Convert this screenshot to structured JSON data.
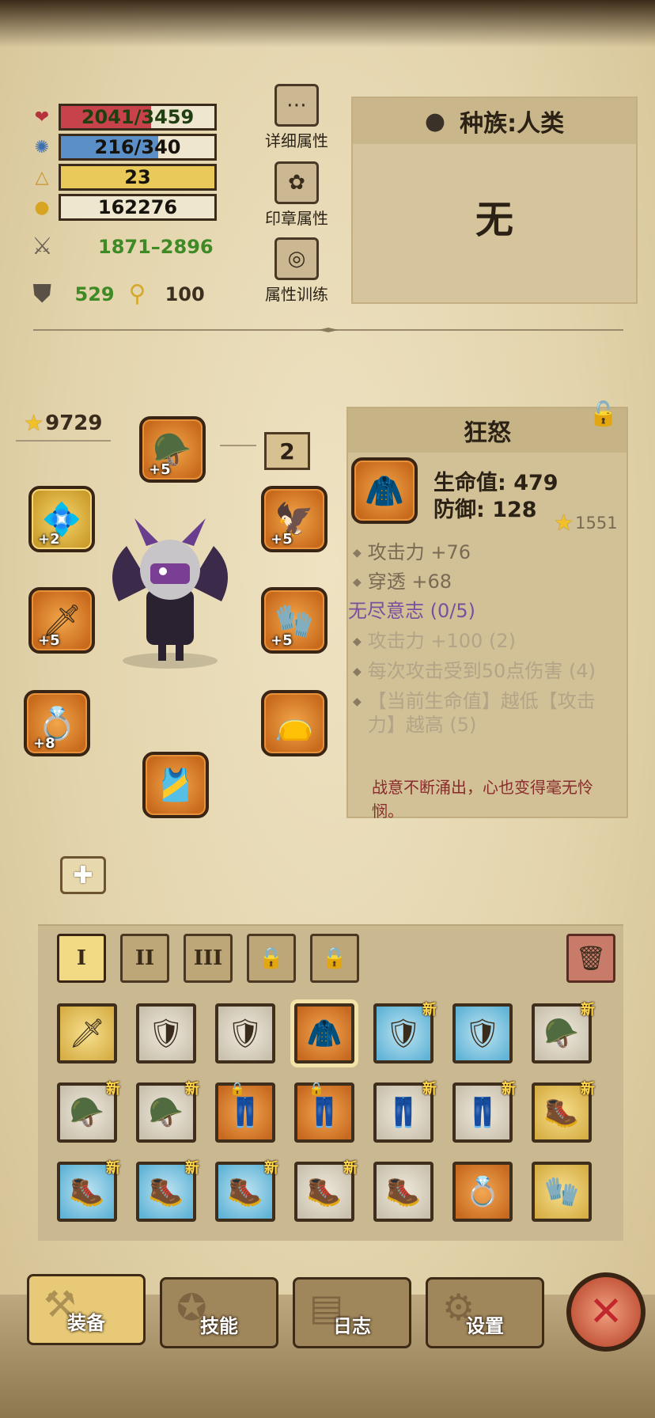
{
  "stats": {
    "hp": {
      "text": "2041/3459",
      "fraction": 0.59,
      "color": "#c8424c"
    },
    "mp": {
      "text": "216/340",
      "fraction": 0.635,
      "color": "#5b8fc7"
    },
    "level": {
      "text": "23",
      "fraction": 1.0,
      "color": "#e8c95a"
    },
    "gold": {
      "text": "162276"
    },
    "attack": "1871–2896",
    "defense": "529",
    "luck": "100"
  },
  "side_buttons": {
    "detail": "详细属性",
    "seal": "印章属性",
    "training": "属性训练"
  },
  "race": {
    "title": "种族:人类",
    "value": "无"
  },
  "equipment": {
    "score": "9729",
    "count": "2",
    "slots": [
      {
        "name": "helmet",
        "level": "+5"
      },
      {
        "name": "amulet",
        "level": "+2"
      },
      {
        "name": "claw",
        "level": "+5"
      },
      {
        "name": "sword",
        "level": "+5"
      },
      {
        "name": "gauntlet",
        "level": "+5"
      },
      {
        "name": "ring",
        "level": "+8"
      },
      {
        "name": "belt",
        "level": ""
      },
      {
        "name": "armor",
        "level": ""
      }
    ]
  },
  "item": {
    "name": "狂怒",
    "hp": "生命值: 479",
    "def": "防御: 128",
    "score": "1551",
    "attrs": [
      "攻击力 +76",
      "穿透 +68"
    ],
    "set_title": "无尽意志 (0/5)",
    "set_bonuses": [
      "攻击力 +100 (2)",
      "每次攻击受到50点伤害 (4)",
      "【当前生命值】越低【攻击力】越高 (5)"
    ],
    "flavor": "战意不断涌出，心也变得毫无怜悯。"
  },
  "inventory": {
    "tabs": [
      "I",
      "II",
      "III"
    ],
    "new_label": "新",
    "rows": [
      [
        {
          "q": "gold",
          "icon": "🗡",
          "new": false
        },
        {
          "q": "grey",
          "icon": "🛡",
          "new": false
        },
        {
          "q": "grey",
          "icon": "🛡",
          "new": false
        },
        {
          "q": "orange",
          "icon": "🧥",
          "new": false,
          "selected": true
        },
        {
          "q": "blue",
          "icon": "🛡",
          "new": true
        },
        {
          "q": "blue",
          "icon": "🛡",
          "new": false
        },
        {
          "q": "grey",
          "icon": "🪖",
          "new": true
        }
      ],
      [
        {
          "q": "grey",
          "icon": "🪖",
          "new": true
        },
        {
          "q": "grey",
          "icon": "🪖",
          "new": true
        },
        {
          "q": "orange",
          "icon": "👖",
          "new": false,
          "locked": true
        },
        {
          "q": "orange",
          "icon": "👖",
          "new": false,
          "locked": true
        },
        {
          "q": "grey",
          "icon": "👖",
          "new": true
        },
        {
          "q": "grey",
          "icon": "👖",
          "new": true
        },
        {
          "q": "gold",
          "icon": "🥾",
          "new": true
        }
      ],
      [
        {
          "q": "blue",
          "icon": "🥾",
          "new": true
        },
        {
          "q": "blue",
          "icon": "🥾",
          "new": true
        },
        {
          "q": "blue",
          "icon": "🥾",
          "new": true
        },
        {
          "q": "grey",
          "icon": "🥾",
          "new": true
        },
        {
          "q": "grey",
          "icon": "🥾",
          "new": false
        },
        {
          "q": "orange",
          "icon": "💍",
          "new": false
        },
        {
          "q": "gold",
          "icon": "🧤",
          "new": false
        }
      ]
    ]
  },
  "nav": {
    "equip": "装备",
    "skill": "技能",
    "log": "日志",
    "settings": "设置"
  }
}
